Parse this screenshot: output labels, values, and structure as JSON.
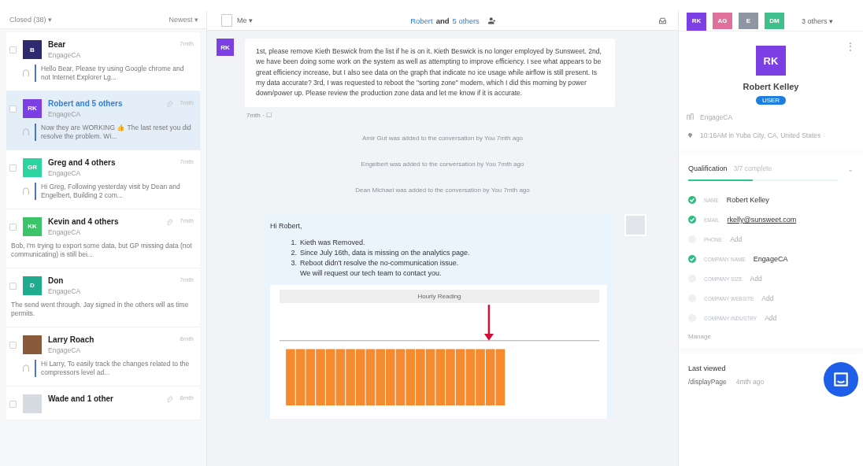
{
  "inbox": {
    "filter": "Closed (38) ▾",
    "sort": "Newest ▾",
    "conversations": [
      {
        "name": "Bear",
        "company": "EngageCA",
        "time": "7mth",
        "avatar": {
          "kind": "initials",
          "text": "B",
          "color": "#2d2a6e"
        },
        "attachment": false,
        "reply": true,
        "selected": false,
        "preview": "Hello Bear, Please try using Google chrome and not Internet Explorer Lg..."
      },
      {
        "name": "Robert and 5 others",
        "company": "EngageCA",
        "time": "7mth",
        "avatar": {
          "kind": "initials",
          "text": "RK",
          "color": "#7b3fe4"
        },
        "attachment": true,
        "reply": true,
        "selected": true,
        "preview": "Now they are WORKING 👍 The last reset you did resolve the problem. Wi..."
      },
      {
        "name": "Greg and 4 others",
        "company": "EngageCA",
        "time": "7mth",
        "avatar": {
          "kind": "initials",
          "text": "GR",
          "color": "#2dd4a0"
        },
        "attachment": false,
        "reply": true,
        "selected": false,
        "preview": "Hi Greg, Following yesterday visit by Dean and Engelbert, Building 2 com..."
      },
      {
        "name": "Kevin and 4 others",
        "company": "EngageCA",
        "time": "7mth",
        "avatar": {
          "kind": "initials",
          "text": "KK",
          "color": "#3cc46a"
        },
        "attachment": true,
        "reply": false,
        "selected": false,
        "preview": "Bob, I'm trying to export some data, but GP missing data (not communicating) is still bei..."
      },
      {
        "name": "Don",
        "company": "EngageCA",
        "time": "7mth",
        "avatar": {
          "kind": "initials",
          "text": "D",
          "color": "#1fab8e"
        },
        "attachment": false,
        "reply": false,
        "selected": false,
        "preview": "The send went through. Jay signed in the others will as time permits."
      },
      {
        "name": "Larry Roach",
        "company": "EngageCA",
        "time": "8mth",
        "avatar": {
          "kind": "photo",
          "color": "#8a5a3c"
        },
        "attachment": false,
        "reply": true,
        "selected": false,
        "preview": "Hi Larry, To easily track the changes related to the compressors level ad..."
      },
      {
        "name": "Wade and 1 other",
        "time": "8mth",
        "avatar": {
          "kind": "blank",
          "color": "#d6dbe2"
        },
        "attachment": true,
        "reply": false,
        "selected": false
      }
    ]
  },
  "conversation": {
    "assignee": "Me ▾",
    "title_parts": [
      {
        "text": "Robert",
        "link": true
      },
      {
        "text": "and",
        "link": false
      },
      {
        "text": "5 others",
        "link": true
      }
    ],
    "messages": [
      {
        "kind": "incoming",
        "avatar": "RK",
        "text": "1st, please remove Kieth Beswick from the list if he is on it. Kieth Beswick is no longer employed by Sunsweet. 2nd, we have been doing some work on the system as well as attempting to improve efficiency. I see what appears to be great efficiency increase, but I also see data on the graph that indicate no ice usage while airflow is still present. Is my data accurate? 3rd, I was requested to reboot the \"sorting zone\" modem, which I did this morning by power down/power up. Please review the production zone data and let me know if it is accurate.",
        "meta": "7mth · ☐"
      },
      {
        "kind": "event",
        "text": "Amir Gut was added to the conversation by You 7mth ago"
      },
      {
        "kind": "event",
        "text": "Engelbert was added to the conversation by You 7mth ago"
      },
      {
        "kind": "event",
        "text": "Dean Michael was added to the conversation by You 7mth ago"
      },
      {
        "kind": "outgoing",
        "greeting": "Hi Robert,",
        "items": [
          {
            "marker": "1.",
            "text": "Kieth was Removed."
          },
          {
            "marker": "2.",
            "text": "Since July 16th, data is missing on the analytics page."
          },
          {
            "marker": "3.",
            "text": "Reboot didn't resolve the no-communication issue."
          }
        ],
        "note": "We will request our tech team to contact you.",
        "chart_title": "Hourly Reading"
      }
    ]
  },
  "profile": {
    "participants": [
      {
        "initials": "RK",
        "color": "#7b3fe4",
        "selected": true
      },
      {
        "initials": "AG",
        "color": "#e0709a",
        "selected": false
      },
      {
        "initials": "E",
        "color": "#8d96a2",
        "selected": false
      },
      {
        "initials": "DM",
        "color": "#3fbf8c",
        "selected": false
      }
    ],
    "more": "3 others ▾",
    "menu": "⋮",
    "initials": "RK",
    "name": "Robert Kelley",
    "badge": "USER",
    "company": "EngageCA",
    "location": "10:16AM in Yuba City, CA, United States",
    "qualification": {
      "title": "Qualification",
      "progress": "3/7 complete",
      "collapse": "⌄",
      "level": 0.43,
      "fields": [
        {
          "label": "NAME",
          "value": "Robert Kelley",
          "checked": true,
          "kind": "text"
        },
        {
          "label": "EMAIL",
          "value": "rkelly@sunsweet.com",
          "checked": true,
          "kind": "link"
        },
        {
          "label": "PHONE",
          "value": "Add",
          "checked": false,
          "kind": "add"
        },
        {
          "label": "COMPANY NAME",
          "value": "EngageCA",
          "checked": true,
          "kind": "text"
        },
        {
          "label": "COMPANY SIZE",
          "value": "Add",
          "checked": false,
          "kind": "add"
        },
        {
          "label": "COMPANY WEBSITE",
          "value": "Add",
          "checked": false,
          "kind": "add"
        },
        {
          "label": "COMPANY INDUSTRY",
          "value": "Add",
          "checked": false,
          "kind": "add"
        }
      ],
      "manage": "Manage"
    },
    "last_viewed": {
      "title": "Last viewed",
      "page": "/displayPage",
      "time": "4mth ago"
    }
  }
}
